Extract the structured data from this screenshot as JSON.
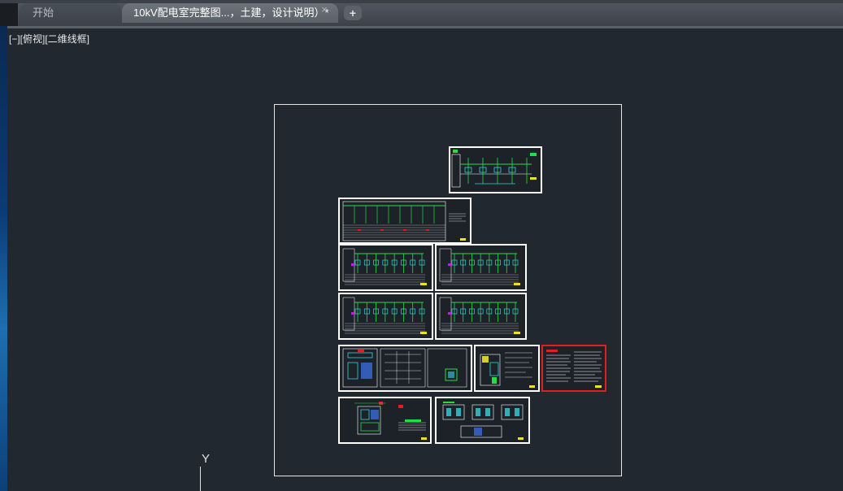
{
  "tabs": [
    {
      "label": "开始",
      "active": false
    },
    {
      "label": "10kV配电室完整图...，土建，设计说明）*",
      "active": true
    }
  ],
  "tab_close_glyph": "×",
  "new_tab_glyph": "+",
  "viewport": {
    "view_label": "[−][俯视][二维线框]",
    "ucs_axis_label": "Y",
    "background": "#212830"
  },
  "drawing_sheets": [
    {
      "name": "single-line-diagram",
      "highlighted": false
    },
    {
      "name": "switchgear-elevation-table",
      "highlighted": false
    },
    {
      "name": "schematic-1",
      "highlighted": false
    },
    {
      "name": "schematic-2",
      "highlighted": false
    },
    {
      "name": "schematic-3",
      "highlighted": false
    },
    {
      "name": "schematic-4",
      "highlighted": false
    },
    {
      "name": "layout-plan-1",
      "highlighted": false
    },
    {
      "name": "layout-plan-2",
      "highlighted": false
    },
    {
      "name": "design-notes",
      "highlighted": true
    },
    {
      "name": "civil-plan",
      "highlighted": false
    },
    {
      "name": "civil-elevations",
      "highlighted": false
    }
  ],
  "colors": {
    "accent_green": "#22e044",
    "accent_cyan": "#34d3e0",
    "accent_yellow": "#f0e020",
    "accent_red": "#e02020",
    "selection_border": "#e02020"
  }
}
